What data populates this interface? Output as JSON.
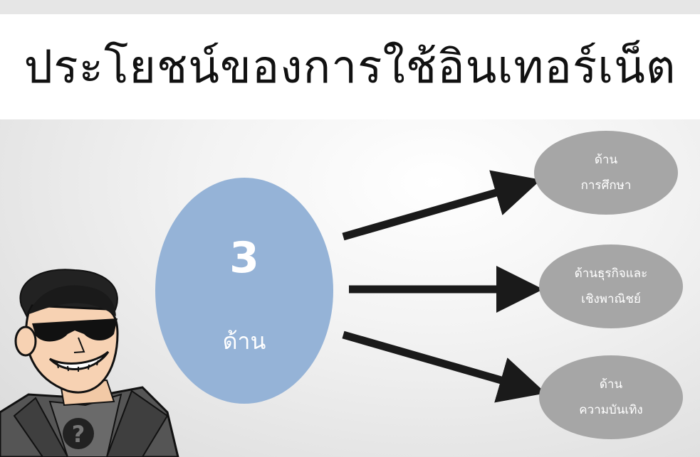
{
  "title": "ประโยชน์ของการใช้อินเทอร์เน็ต",
  "center": {
    "number": "3",
    "label": "ด้าน"
  },
  "nodes": [
    {
      "line1": "ด้าน",
      "line2": "การศึกษา"
    },
    {
      "line1": "ด้านธุรกิจและ",
      "line2": "เชิงพาณิชย์"
    },
    {
      "line1": "ด้าน",
      "line2": "ความบันเทิง"
    }
  ],
  "colors": {
    "center_circle": "#95b3d7",
    "node_fill": "#a6a6a6",
    "arrow": "#1a1a1a"
  },
  "icons": [
    "cartoon-man-sunglasses-icon",
    "arrow-icon"
  ]
}
